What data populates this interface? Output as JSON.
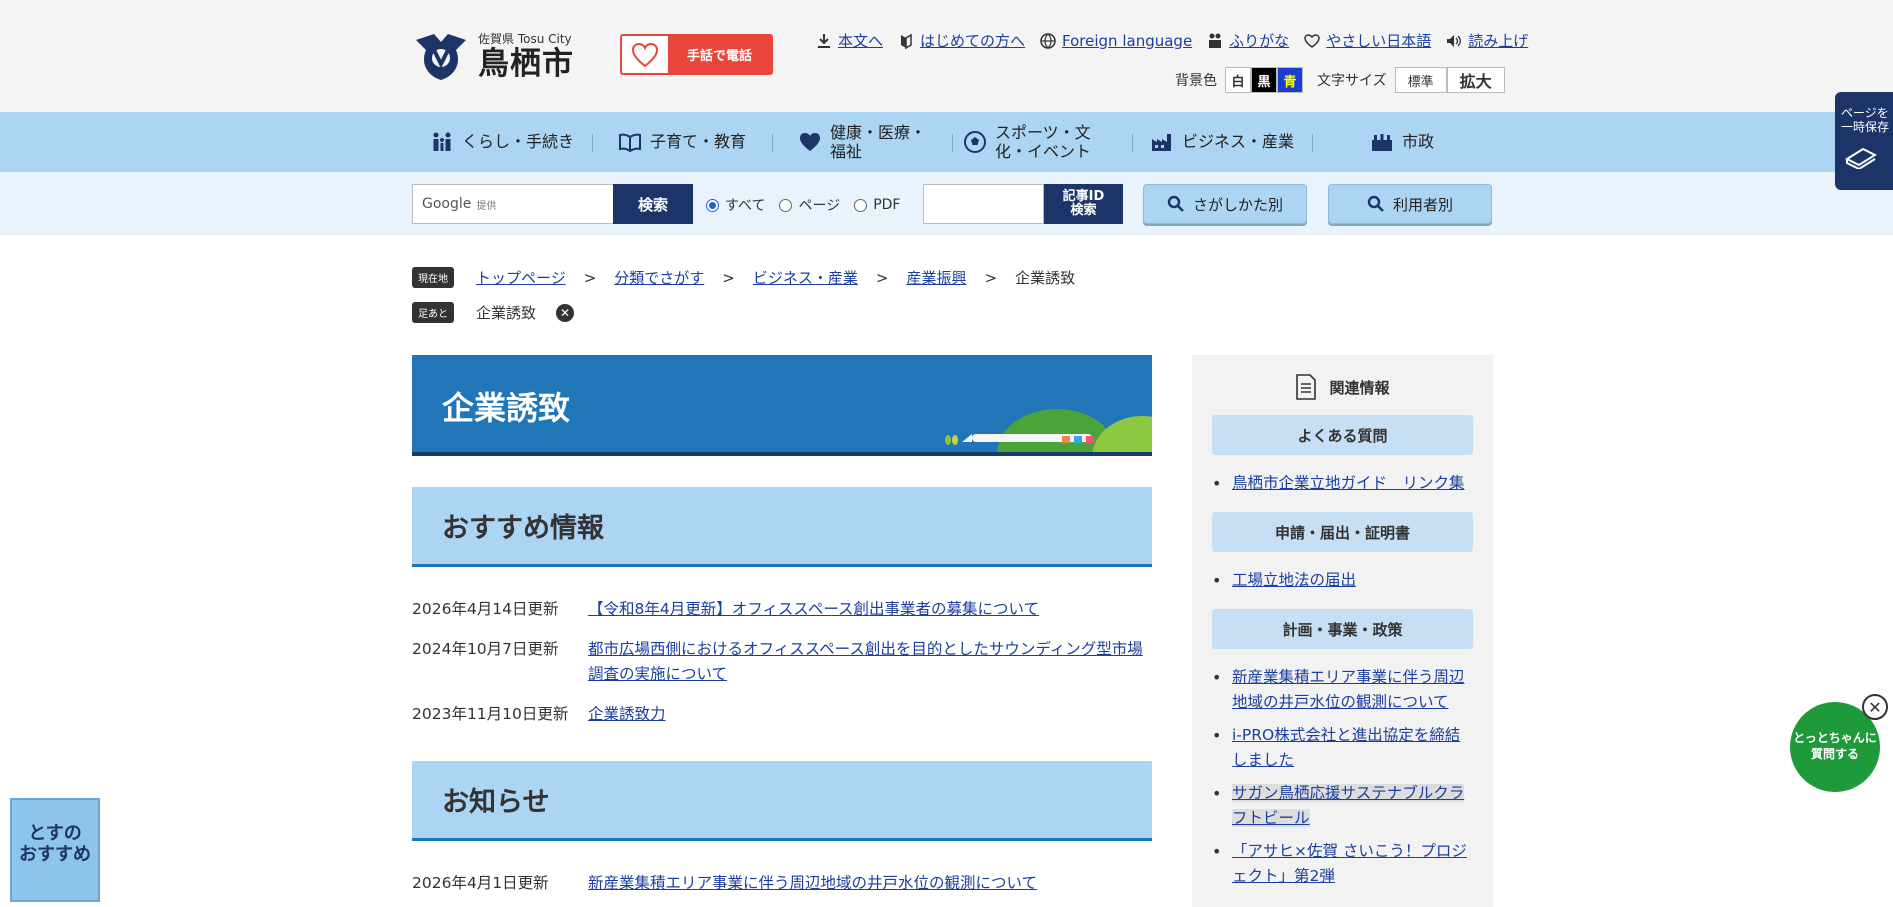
{
  "header": {
    "logo_sub": "佐賀県 Tosu City",
    "logo_name": "鳥栖市",
    "tel_badge": "手話で電話",
    "util_links": [
      "本文へ",
      "はじめての方へ",
      "Foreign language",
      "ふりがな",
      "やさしい日本語",
      "読み上げ"
    ],
    "bg_color_label": "背景色",
    "bg_colors": [
      "白",
      "黒",
      "青"
    ],
    "font_size_label": "文字サイズ",
    "font_normal": "標準",
    "font_large": "拡大"
  },
  "nav": [
    {
      "label": "くらし・手続き",
      "icon": "family-icon"
    },
    {
      "label": "子育て・教育",
      "icon": "book-icon"
    },
    {
      "label": "健康・医療・福祉",
      "icon": "heart-icon"
    },
    {
      "label": "スポーツ・文化・イベント",
      "icon": "ball-icon"
    },
    {
      "label": "ビジネス・産業",
      "icon": "factory-icon"
    },
    {
      "label": "市政",
      "icon": "cityhall-icon"
    }
  ],
  "search": {
    "google_label": "Google",
    "google_sub": "提供",
    "button": "検索",
    "radio_all": "すべて",
    "radio_page": "ページ",
    "radio_pdf": "PDF",
    "id_button": "記事ID\n検索",
    "find_by_way": "さがしかた別",
    "find_by_user": "利用者別"
  },
  "breadcrumb": {
    "tag": "現在地",
    "items": [
      "トップページ",
      "分類でさがす",
      "ビジネス・産業",
      "産業振興"
    ],
    "current": "企業誘致",
    "trail_tag": "足あと",
    "trail_item": "企業誘致"
  },
  "main": {
    "title": "企業誘致",
    "section1": "おすすめ情報",
    "news1": [
      {
        "date": "2026年4月14日更新",
        "title": "【令和8年4月更新】オフィススペース創出事業者の募集について"
      },
      {
        "date": "2024年10月7日更新",
        "title": "都市広場西側におけるオフィススペース創出を目的としたサウンディング型市場調査の実施について"
      },
      {
        "date": "2023年11月10日更新",
        "title": "企業誘致力"
      }
    ],
    "section2": "お知らせ",
    "news2": [
      {
        "date": "2026年4月1日更新",
        "title": "新産業集積エリア事業に伴う周辺地域の井戸水位の観測について"
      }
    ]
  },
  "sidebar": {
    "heading": "関連情報",
    "cat1": "よくある質問",
    "cat1_items": [
      "鳥栖市企業立地ガイド　リンク集"
    ],
    "cat2": "申請・届出・証明書",
    "cat2_items": [
      "工場立地法の届出"
    ],
    "cat3": "計画・事業・政策",
    "cat3_items": [
      "新産業集積エリア事業に伴う周辺地域の井戸水位の観測について",
      "i-PRO株式会社と進出協定を締結しました",
      "サガン鳥栖応援サステナブルクラフトビール",
      "「アサヒ×佐賀 さいこう！プロジェクト」第2弾"
    ]
  },
  "floating": {
    "save": "ページを\n一時保存",
    "chat": "とっとちゃんに\n質問する",
    "tosu": "とすの\nおすすめ"
  },
  "colors": {
    "nav_bg": "#acd4f3",
    "dark_navy": "#1c3468",
    "banner_blue": "#2176b8"
  }
}
